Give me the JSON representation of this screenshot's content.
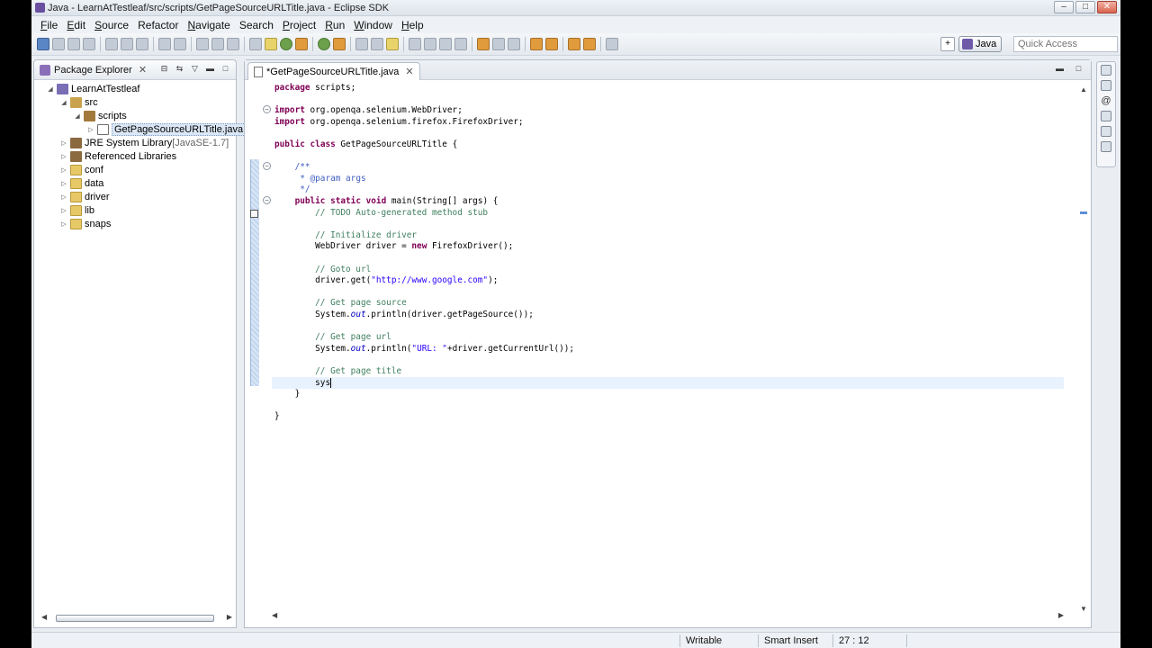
{
  "window": {
    "title": "Java - LearnAtTestleaf/src/scripts/GetPageSourceURLTitle.java - Eclipse SDK",
    "controls": [
      "–",
      "□",
      "✕"
    ]
  },
  "menu": [
    {
      "label": "File",
      "key": "F",
      "rest": "ile"
    },
    {
      "label": "Edit",
      "key": "E",
      "rest": "dit"
    },
    {
      "label": "Source",
      "key": "S",
      "rest": "ource"
    },
    {
      "label": "Refactor",
      "key": "",
      "rest": "Refactor"
    },
    {
      "label": "Navigate",
      "key": "N",
      "rest": "avigate"
    },
    {
      "label": "Search",
      "key": "",
      "rest": "Search"
    },
    {
      "label": "Project",
      "key": "P",
      "rest": "roject"
    },
    {
      "label": "Run",
      "key": "R",
      "rest": "un"
    },
    {
      "label": "Window",
      "key": "W",
      "rest": "indow"
    },
    {
      "label": "Help",
      "key": "H",
      "rest": "elp"
    }
  ],
  "toolbar": {
    "perspective": "Java",
    "quick_access_placeholder": "Quick Access"
  },
  "package_explorer": {
    "title": "Package Explorer",
    "tree": [
      {
        "label": "LearnAtTestleaf",
        "muted": "",
        "icon": "project-icon",
        "twisty": "◢",
        "indent": 0
      },
      {
        "label": "src",
        "muted": "",
        "icon": "source-folder-icon",
        "twisty": "◢",
        "indent": 1
      },
      {
        "label": "scripts",
        "muted": "",
        "icon": "package-icon",
        "twisty": "◢",
        "indent": 2
      },
      {
        "label": "GetPageSourceURLTitle.java",
        "muted": "",
        "icon": "java-file-icon",
        "twisty": "▷",
        "indent": 3,
        "selected": true
      },
      {
        "label": "JRE System Library ",
        "muted": "[JavaSE-1.7]",
        "icon": "library-icon",
        "twisty": "▷",
        "indent": 1
      },
      {
        "label": "Referenced Libraries",
        "muted": "",
        "icon": "library-icon",
        "twisty": "▷",
        "indent": 1
      },
      {
        "label": "conf",
        "muted": "",
        "icon": "folder-icon",
        "twisty": "▷",
        "indent": 1
      },
      {
        "label": "data",
        "muted": "",
        "icon": "folder-icon",
        "twisty": "▷",
        "indent": 1
      },
      {
        "label": "driver",
        "muted": "",
        "icon": "folder-icon",
        "twisty": "▷",
        "indent": 1
      },
      {
        "label": "lib",
        "muted": "",
        "icon": "folder-icon",
        "twisty": "▷",
        "indent": 1
      },
      {
        "label": "snaps",
        "muted": "",
        "icon": "folder-icon",
        "twisty": "▷",
        "indent": 1
      }
    ]
  },
  "editor": {
    "tab_label": "*GetPageSourceURLTitle.java",
    "lines": [
      [
        {
          "t": "package",
          "c": "kw"
        },
        {
          "t": " scripts;",
          "c": ""
        }
      ],
      [],
      [
        {
          "t": "import",
          "c": "kw"
        },
        {
          "t": " org.openqa.selenium.WebDriver;",
          "c": ""
        }
      ],
      [
        {
          "t": "import",
          "c": "kw"
        },
        {
          "t": " org.openqa.selenium.firefox.FirefoxDriver;",
          "c": ""
        }
      ],
      [],
      [
        {
          "t": "public",
          "c": "kw"
        },
        {
          "t": " ",
          "c": ""
        },
        {
          "t": "class",
          "c": "kw"
        },
        {
          "t": " GetPageSourceURLTitle {",
          "c": ""
        }
      ],
      [],
      [
        {
          "t": "    /**",
          "c": "jd"
        }
      ],
      [
        {
          "t": "     * ",
          "c": "jd"
        },
        {
          "t": "@param",
          "c": "jd"
        },
        {
          "t": " args",
          "c": "jd"
        }
      ],
      [
        {
          "t": "     */",
          "c": "jd"
        }
      ],
      [
        {
          "t": "    ",
          "c": ""
        },
        {
          "t": "public",
          "c": "kw"
        },
        {
          "t": " ",
          "c": ""
        },
        {
          "t": "static",
          "c": "kw"
        },
        {
          "t": " ",
          "c": ""
        },
        {
          "t": "void",
          "c": "kw"
        },
        {
          "t": " main(String[] args) {",
          "c": ""
        }
      ],
      [
        {
          "t": "        // TODO Auto-generated method stub",
          "c": "cm"
        }
      ],
      [],
      [
        {
          "t": "        // Initialize driver",
          "c": "cm"
        }
      ],
      [
        {
          "t": "        WebDriver driver = ",
          "c": ""
        },
        {
          "t": "new",
          "c": "kw"
        },
        {
          "t": " FirefoxDriver();",
          "c": ""
        }
      ],
      [],
      [
        {
          "t": "        // Goto url",
          "c": "cm"
        }
      ],
      [
        {
          "t": "        driver.get(",
          "c": ""
        },
        {
          "t": "\"http://www.google.com\"",
          "c": "st"
        },
        {
          "t": ");",
          "c": ""
        }
      ],
      [],
      [
        {
          "t": "        // Get page source",
          "c": "cm"
        }
      ],
      [
        {
          "t": "        System.",
          "c": ""
        },
        {
          "t": "out",
          "c": "it"
        },
        {
          "t": ".println(driver.getPageSource());",
          "c": ""
        }
      ],
      [],
      [
        {
          "t": "        // Get page url",
          "c": "cm"
        }
      ],
      [
        {
          "t": "        System.",
          "c": ""
        },
        {
          "t": "out",
          "c": "it"
        },
        {
          "t": ".println(",
          "c": ""
        },
        {
          "t": "\"URL: \"",
          "c": "st"
        },
        {
          "t": "+driver.getCurrentUrl());",
          "c": ""
        }
      ],
      [],
      [
        {
          "t": "        // Get page title",
          "c": "cm"
        }
      ],
      [
        {
          "t": "        sys",
          "c": ""
        },
        {
          "t": "",
          "c": "caret"
        }
      ],
      [
        {
          "t": "    }",
          "c": ""
        }
      ],
      [],
      [
        {
          "t": "}",
          "c": ""
        }
      ]
    ]
  },
  "status": {
    "writable": "Writable",
    "insert_mode": "Smart Insert",
    "position": "27 : 12"
  }
}
